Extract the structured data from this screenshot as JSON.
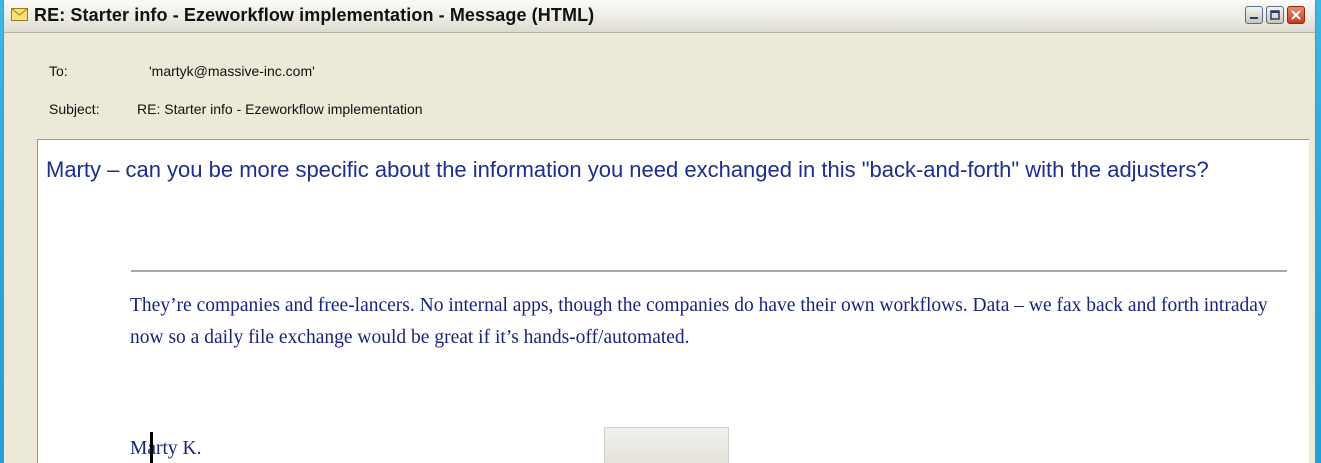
{
  "window": {
    "title": "RE: Starter info - Ezeworkflow implementation - Message (HTML)",
    "icon": "envelope-icon",
    "controls": [
      "minimize-icon",
      "maximize-icon",
      "close-icon"
    ]
  },
  "headers": {
    "to_label": "To:",
    "to_value": "'martyk@massive-inc.com'",
    "subject_label": "Subject:",
    "subject_value": "RE: Starter info - Ezeworkflow implementation"
  },
  "message": {
    "reply_text": "Marty – can you be more specific about the information you need exchanged in this \"back-and-forth\" with the adjusters?",
    "quoted_text": "They’re companies and free-lancers. No internal apps, though the companies do have their own workflows. Data – we fax back and forth intraday now so a daily file exchange would be great if it’s hands-off/automated.",
    "signature": "Marty K."
  },
  "colors": {
    "reply_text": "#1c2e8e",
    "quoted_text": "#1a237e",
    "desktop": "#2aa3d6"
  }
}
